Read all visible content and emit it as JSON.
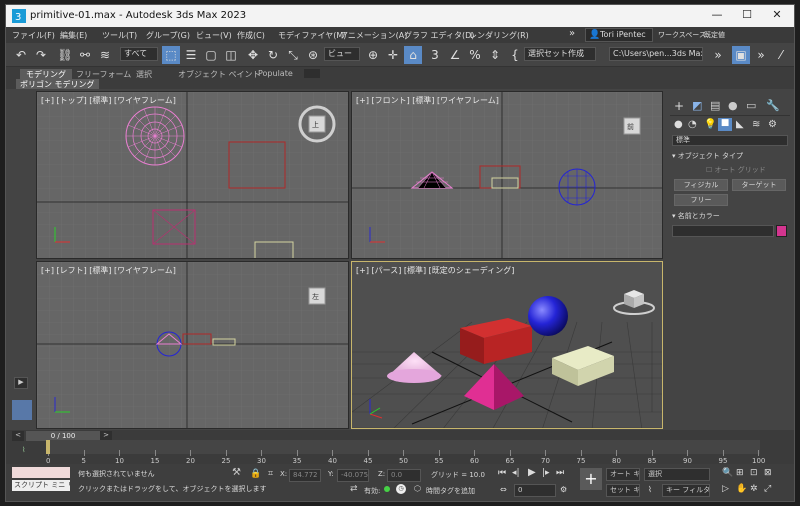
{
  "window": {
    "title": "primitive-01.max - Autodesk 3ds Max 2023",
    "min": "—",
    "max": "☐",
    "close": "✕"
  },
  "menu": {
    "items": [
      "ファイル(F)",
      "編集(E)",
      "ツール(T)",
      "グループ(G)",
      "ビュー(V)",
      "作成(C)",
      "モディファイヤ(M)",
      "アニメーション(A)",
      "グラフ エディタ(D)",
      "レンダリング(R)"
    ],
    "overflow": "»",
    "user": "Tori iPentec",
    "workspace_label": "ワークスペース:",
    "workspace_value": "既定値"
  },
  "toolbar": {
    "filter": "すべて",
    "refcoord": "ビュー",
    "selset": "選択セット作成",
    "path": "C:\\Users\\pen...3ds Max 2023"
  },
  "ribbon": {
    "tabs": [
      "モデリング",
      "フリーフォーム",
      "選択",
      "オブジェクト ペイント",
      "Populate"
    ],
    "sub": "ポリゴン モデリング"
  },
  "viewports": {
    "top": "[+] [トップ] [標準] [ワイヤフレーム]",
    "front": "[+] [フロント] [標準] [ワイヤフレーム]",
    "left": "[+] [レフト] [標準] [ワイヤフレーム]",
    "persp": "[+] [パース] [標準] [既定のシェーディング]",
    "cube_top": "上",
    "cube_front": "前",
    "cube_left": "左"
  },
  "cmdpanel": {
    "category": "標準",
    "rollout_objtype": "オブジェクト タイプ",
    "autogrid": "オート グリッド",
    "btn_physical": "フィジカル",
    "btn_target": "ターゲット",
    "btn_free": "フリー",
    "rollout_name": "名前とカラー",
    "swatch_color": "#d3358f"
  },
  "timeline": {
    "frame": "0 / 100",
    "ticks": [
      "0",
      "5",
      "10",
      "15",
      "20",
      "25",
      "30",
      "35",
      "40",
      "45",
      "50",
      "55",
      "60",
      "65",
      "70",
      "75",
      "80",
      "85",
      "90",
      "95",
      "100"
    ]
  },
  "status": {
    "script": "スクリプト ミニ リス",
    "msg1": "何も選択されていません",
    "msg2": "クリックまたはドラッグをして、オブジェクトを選択します",
    "x_label": "X:",
    "x_val": "84.772",
    "y_label": "Y:",
    "y_val": "-40.075",
    "z_label": "Z:",
    "z_val": "0.0",
    "grid": "グリッド = 10.0",
    "enable": "有効:",
    "addtime": "時間タグを追加",
    "autokey": "オート キー",
    "setkey": "セット キー",
    "selected": "選択",
    "keyfilter": "キー フィルタ...",
    "frame_field": "0"
  }
}
